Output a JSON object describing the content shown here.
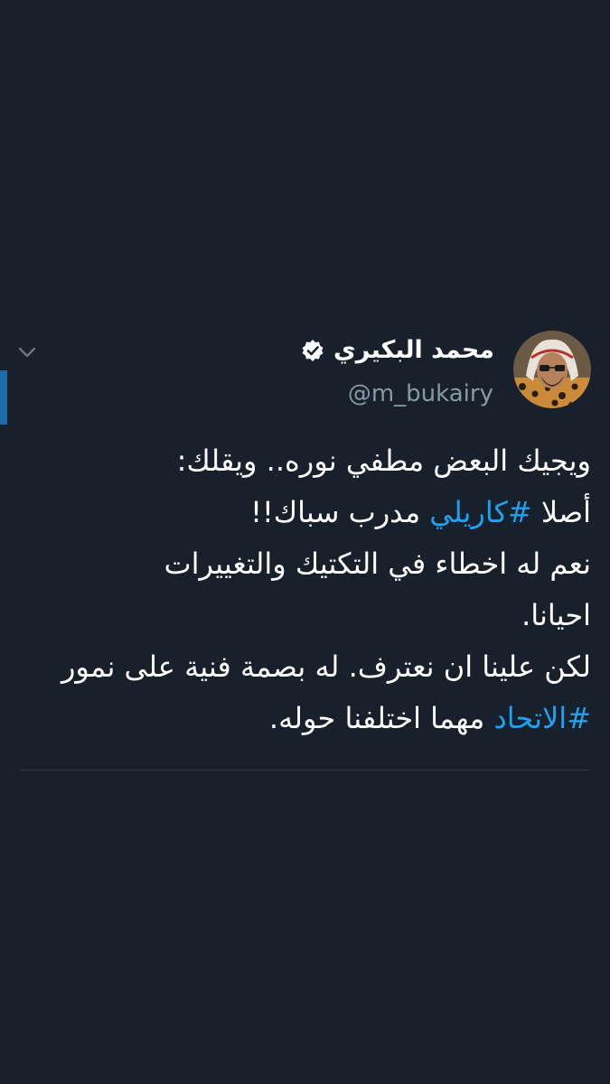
{
  "tweet": {
    "author": {
      "display_name": "محمد البكيري",
      "handle": "@m_bukairy",
      "verified": true,
      "verified_icon": "verified-badge-icon",
      "avatar_icon": "profile-avatar"
    },
    "menu_icon": "chevron-down-icon",
    "text": {
      "line1": "ويجيك البعض مطفي نوره.. ويقلك:",
      "line2_prefix": "أصلا ",
      "line2_hashtag": "#كاريلي",
      "line2_suffix": " مدرب سباك!!",
      "line3": "نعم له اخطاء في التكتيك والتغييرات",
      "line4": "احيانا.",
      "line5": "لكن علينا ان نعترف. له بصمة فنية على نمور",
      "line6_hashtag": "#الاتحاد",
      "line6_suffix": " مهما اختلفنا حوله."
    }
  },
  "colors": {
    "background": "#17202b",
    "text": "#ffffff",
    "secondary_text": "#8899a6",
    "hashtag": "#1da1f2",
    "accent_bar": "#1d6ea8"
  }
}
